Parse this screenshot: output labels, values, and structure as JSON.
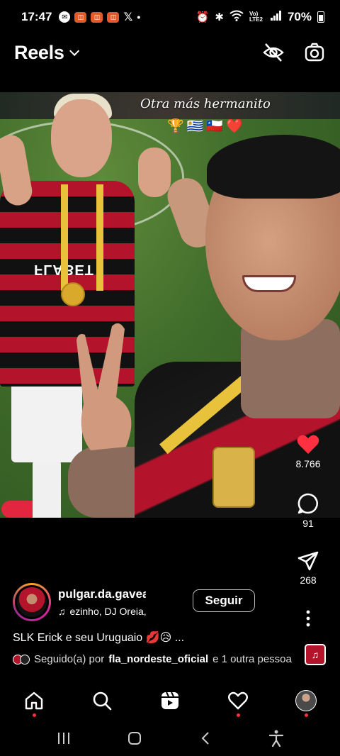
{
  "status_bar": {
    "time": "17:47",
    "network": "Vo) LTE2",
    "battery": "70%"
  },
  "header": {
    "title": "Reels"
  },
  "video": {
    "overlay_text": "Otra más hermanito",
    "overlay_emojis": "🏆🇺🇾🇨🇱❤️",
    "sponsor_text": "FLABET"
  },
  "actions": {
    "likes": "8.766",
    "comments": "91",
    "shares": "268"
  },
  "post": {
    "username": "pulgar.da.gavea",
    "music": "ezinho, DJ Oreia, MC Rya",
    "follow_label": "Seguir",
    "caption": "SLK Erick e seu Uruguaio 💋😥 ...",
    "followed_prefix": "Seguido(a) por",
    "followed_user": "fla_nordeste_oficial",
    "followed_suffix": "e 1 outra pessoa"
  },
  "colors": {
    "like_red": "#ff3040",
    "accent_flamengo": "#b3142b",
    "background": "#000000"
  },
  "icons": {
    "header": [
      "eye-off-icon",
      "camera-icon"
    ],
    "rail": [
      "heart-icon",
      "comment-icon",
      "share-icon",
      "more-icon",
      "audio-icon"
    ],
    "nav": [
      "home-icon",
      "search-icon",
      "reels-icon",
      "heart-icon",
      "profile-avatar"
    ]
  }
}
